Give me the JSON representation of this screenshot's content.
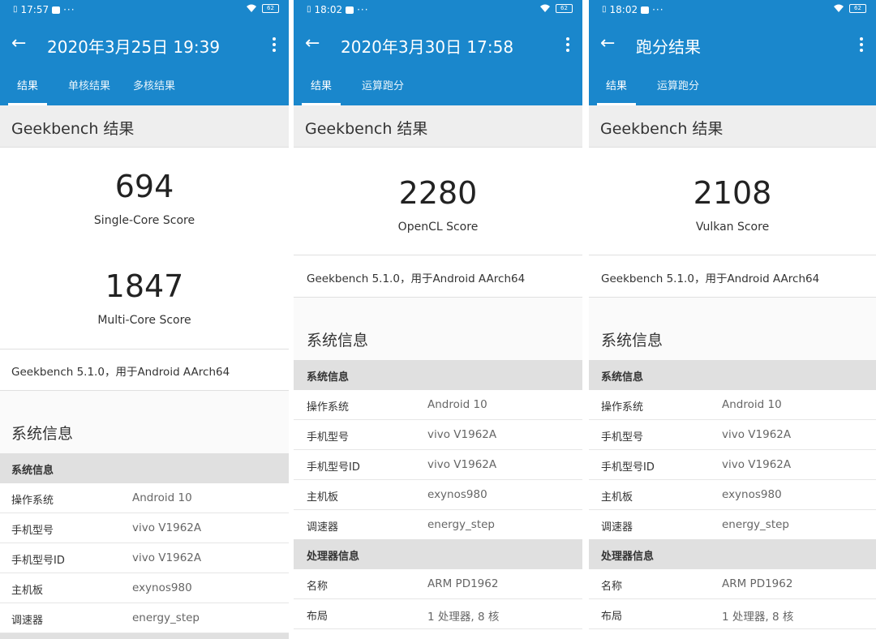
{
  "panels": [
    {
      "status": {
        "time": "17:57",
        "battery": "62"
      },
      "title": "2020年3月25日 19:39",
      "tabs": [
        "结果",
        "单核结果",
        "多核结果"
      ],
      "section_title": "Geekbench 结果",
      "scores": [
        {
          "value": "694",
          "label": "Single-Core Score"
        },
        {
          "value": "1847",
          "label": "Multi-Core Score"
        }
      ],
      "version": "Geekbench 5.1.0，用于Android AArch64",
      "sys_title": "系统信息",
      "group1": "系统信息",
      "rows": [
        {
          "k": "操作系统",
          "v": "Android 10"
        },
        {
          "k": "手机型号",
          "v": "vivo V1962A"
        },
        {
          "k": "手机型号ID",
          "v": "vivo V1962A"
        },
        {
          "k": "主机板",
          "v": "exynos980"
        },
        {
          "k": "调速器",
          "v": "energy_step"
        }
      ]
    },
    {
      "status": {
        "time": "18:02",
        "battery": "62"
      },
      "title": "2020年3月30日 17:58",
      "tabs": [
        "结果",
        "运算跑分"
      ],
      "section_title": "Geekbench 结果",
      "scores": [
        {
          "value": "2280",
          "label": "OpenCL Score"
        }
      ],
      "version": "Geekbench 5.1.0，用于Android AArch64",
      "sys_title": "系统信息",
      "group1": "系统信息",
      "rows": [
        {
          "k": "操作系统",
          "v": "Android 10"
        },
        {
          "k": "手机型号",
          "v": "vivo V1962A"
        },
        {
          "k": "手机型号ID",
          "v": "vivo V1962A"
        },
        {
          "k": "主机板",
          "v": "exynos980"
        },
        {
          "k": "调速器",
          "v": "energy_step"
        }
      ],
      "group2": "处理器信息",
      "rows2": [
        {
          "k": "名称",
          "v": "ARM PD1962"
        },
        {
          "k": "布局",
          "v": "1 处理器, 8 核"
        }
      ]
    },
    {
      "status": {
        "time": "18:02",
        "battery": "62"
      },
      "title": "跑分结果",
      "tabs": [
        "结果",
        "运算跑分"
      ],
      "section_title": "Geekbench 结果",
      "scores": [
        {
          "value": "2108",
          "label": "Vulkan Score"
        }
      ],
      "version": "Geekbench 5.1.0，用于Android AArch64",
      "sys_title": "系统信息",
      "group1": "系统信息",
      "rows": [
        {
          "k": "操作系统",
          "v": "Android 10"
        },
        {
          "k": "手机型号",
          "v": "vivo V1962A"
        },
        {
          "k": "手机型号ID",
          "v": "vivo V1962A"
        },
        {
          "k": "主机板",
          "v": "exynos980"
        },
        {
          "k": "调速器",
          "v": "energy_step"
        }
      ],
      "group2": "处理器信息",
      "rows2": [
        {
          "k": "名称",
          "v": "ARM PD1962"
        },
        {
          "k": "布局",
          "v": "1 处理器, 8 核"
        }
      ]
    }
  ],
  "colors": {
    "appbar": "#1a87cc",
    "section_bg": "#eeeeee",
    "group_bg": "#e0e0e0"
  },
  "icons": [
    "sim-icon",
    "message-icon",
    "wifi-icon",
    "battery-icon",
    "back-arrow-icon",
    "more-vert-icon"
  ]
}
